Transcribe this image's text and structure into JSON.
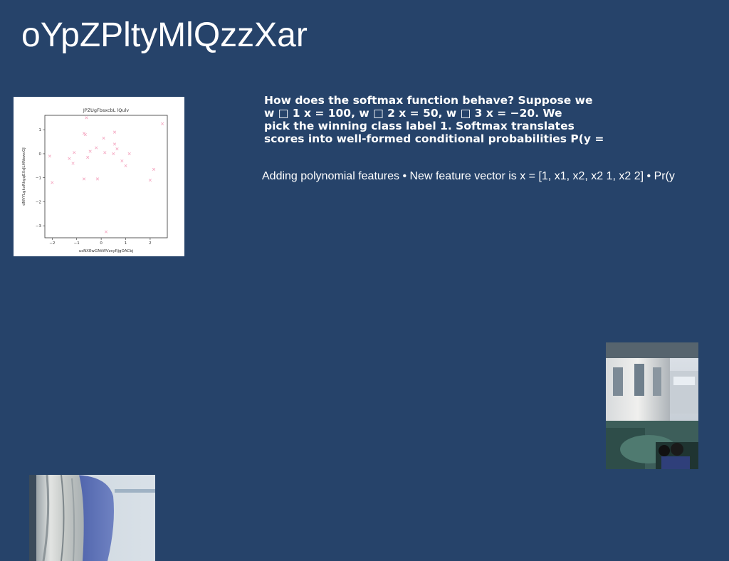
{
  "slide": {
    "title": "oYpZPltyMlQzzXar",
    "paragraph_lines": [
      "How does the softmax function behave? Suppose we",
      "w □ 1 x = 100, w □ 2 x = 50, w □ 3 x = −20. We",
      "pick the winning class label 1. Softmax translates",
      "scores into well-formed conditional probabilities P(y ="
    ],
    "bullet_text": "Adding polynomial features • New feature vector is x = [1, x1, x2, x2 1, x2 2] • Pr(y"
  },
  "chart_data": {
    "type": "scatter",
    "title": "JPZUgFbsxcbL lQulv",
    "xlabel": "usNXEwGNtWVzsyRjgOACbj",
    "ylabel": "dNVYLgkxRkgqEXsJLHNewcGJ",
    "xlim": [
      -2.3,
      2.7
    ],
    "ylim": [
      -3.5,
      1.6
    ],
    "xticks": [
      -2,
      -1,
      0,
      1,
      2
    ],
    "yticks": [
      1,
      0,
      -1,
      -2,
      -3
    ],
    "marker": "x",
    "color": "#f4a6c0",
    "points": [
      {
        "x": -2.1,
        "y": -0.1
      },
      {
        "x": -2.0,
        "y": -1.2
      },
      {
        "x": -1.3,
        "y": -0.2
      },
      {
        "x": -1.15,
        "y": -0.4
      },
      {
        "x": -1.1,
        "y": 0.05
      },
      {
        "x": -0.7,
        "y": 0.85
      },
      {
        "x": -0.65,
        "y": 0.8
      },
      {
        "x": -0.7,
        "y": -1.05
      },
      {
        "x": -0.6,
        "y": 1.5
      },
      {
        "x": -0.55,
        "y": -0.15
      },
      {
        "x": -0.45,
        "y": 0.1
      },
      {
        "x": -0.2,
        "y": 0.25
      },
      {
        "x": -0.15,
        "y": -1.05
      },
      {
        "x": 0.1,
        "y": 0.65
      },
      {
        "x": 0.15,
        "y": 0.05
      },
      {
        "x": 0.2,
        "y": -3.25
      },
      {
        "x": 0.5,
        "y": 0.0
      },
      {
        "x": 0.55,
        "y": 0.4
      },
      {
        "x": 0.55,
        "y": 0.9
      },
      {
        "x": 0.65,
        "y": 0.2
      },
      {
        "x": 0.85,
        "y": -0.3
      },
      {
        "x": 1.0,
        "y": -0.5
      },
      {
        "x": 1.15,
        "y": 0.0
      },
      {
        "x": 2.0,
        "y": -1.1
      },
      {
        "x": 2.15,
        "y": -0.65
      },
      {
        "x": 2.5,
        "y": 1.25
      }
    ]
  }
}
